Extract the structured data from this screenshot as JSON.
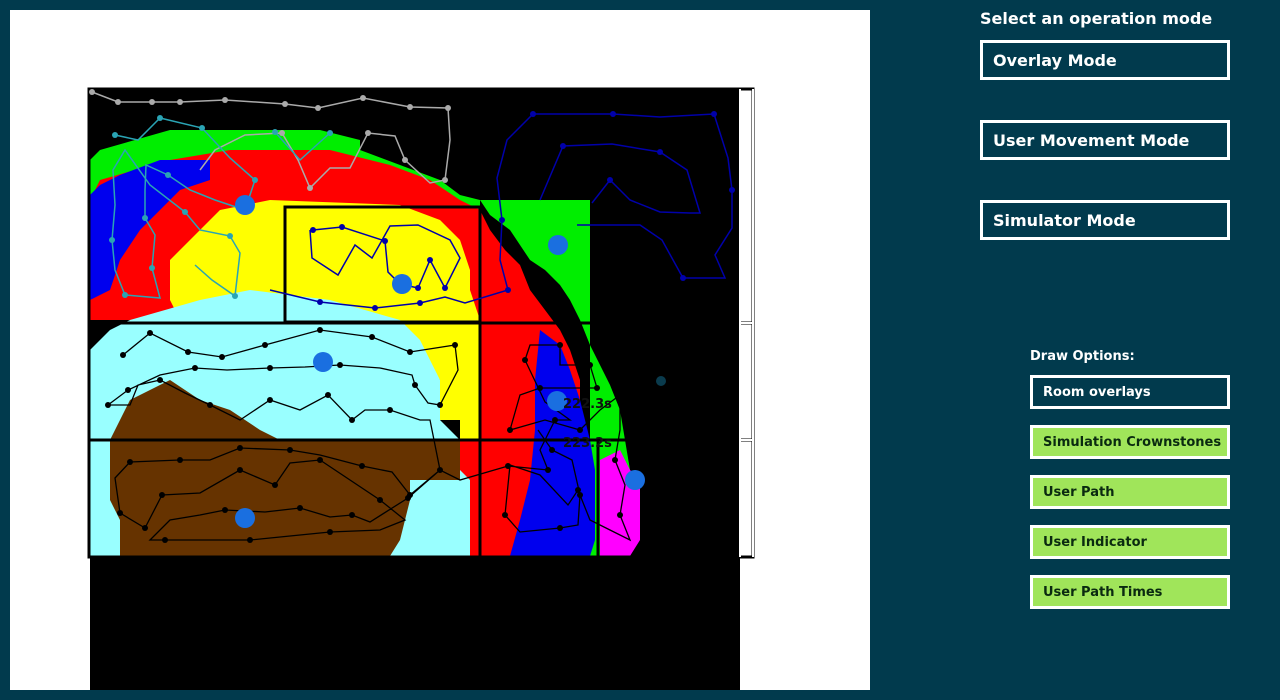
{
  "mode_panel": {
    "title": "Select an operation mode",
    "buttons": [
      "Overlay Mode",
      "User Movement Mode",
      "Simulator Mode"
    ]
  },
  "draw_options": {
    "title": "Draw Options:",
    "items": [
      {
        "label": "Room overlays",
        "enabled": false
      },
      {
        "label": "Simulation Crownstones",
        "enabled": true
      },
      {
        "label": "User Path",
        "enabled": true
      },
      {
        "label": "User Indicator",
        "enabled": true
      },
      {
        "label": "User Path Times",
        "enabled": true
      }
    ]
  },
  "map": {
    "time_labels": [
      "222.3s",
      "223.2s"
    ]
  },
  "colors": {
    "background": "#013a4d",
    "active_option": "#a0e55a",
    "crownstone": "#1a6fe0"
  }
}
